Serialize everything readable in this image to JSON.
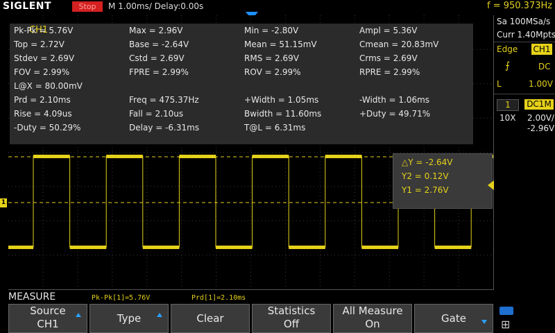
{
  "topbar": {
    "brand": "SIGLENT",
    "run_state": "Stop",
    "timebase": "M 1.00ms/ Delay:0.00s",
    "frequency": "f = 950.373Hz"
  },
  "measurements": {
    "channel": "CH1",
    "items": [
      "Pk-Pk = 5.76V",
      "Max = 2.96V",
      "Min = -2.80V",
      "Ampl = 5.36V",
      "Top = 2.72V",
      "Base = -2.64V",
      "Mean = 51.15mV",
      "Cmean = 20.83mV",
      "Stdev = 2.69V",
      "Cstd = 2.69V",
      "RMS = 2.69V",
      "Crms = 2.69V",
      "FOV = 2.99%",
      "FPRE = 2.99%",
      "ROV = 2.99%",
      "RPRE = 2.99%",
      "L@X = 80.00mV",
      "Prd = 2.10ms",
      "Freq = 475.37Hz",
      "+Width = 1.05ms",
      "-Width = 1.06ms",
      "Rise = 4.09us",
      "Fall = 2.10us",
      "Bwidth = 11.60ms",
      "+Duty = 49.71%",
      "-Duty = 50.29%",
      "Delay = -6.31ms",
      "T@L = 6.31ms"
    ]
  },
  "cursors": {
    "delta_y": "△Y = -2.64V",
    "y2": "Y2 = 0.12V",
    "y1": "Y1 = 2.76V"
  },
  "channel_marker": "1",
  "right_panel": {
    "sample_rate": "Sa 100MSa/s",
    "memory": "Curr 1.40Mpts",
    "trigger_type": "Edge",
    "trigger_source": "CH1",
    "trigger_coupling": "DC",
    "trigger_level_label": "L",
    "trigger_level": "1.00V",
    "channel_number": "1",
    "channel_coupling": "DC1M",
    "probe": "10X",
    "volts_div": "2.00V/",
    "offset": "-2.96V"
  },
  "measure_bar": {
    "title": "MEASURE",
    "value1": "Pk-Pk[1]=5.76V",
    "value2": "Prd[1]=2.10ms"
  },
  "softkeys": {
    "source_line1": "Source",
    "source_line2": "CH1",
    "type": "Type",
    "clear": "Clear",
    "statistics_line1": "Statistics",
    "statistics_line2": "Off",
    "all_measure_line1": "All Measure",
    "all_measure_line2": "On",
    "gate": "Gate"
  },
  "colors": {
    "channel1": "#e6d21a",
    "stop_bg": "#d42020",
    "accent_blue": "#1e90ff",
    "panel_bg": "#2b2b2b"
  }
}
